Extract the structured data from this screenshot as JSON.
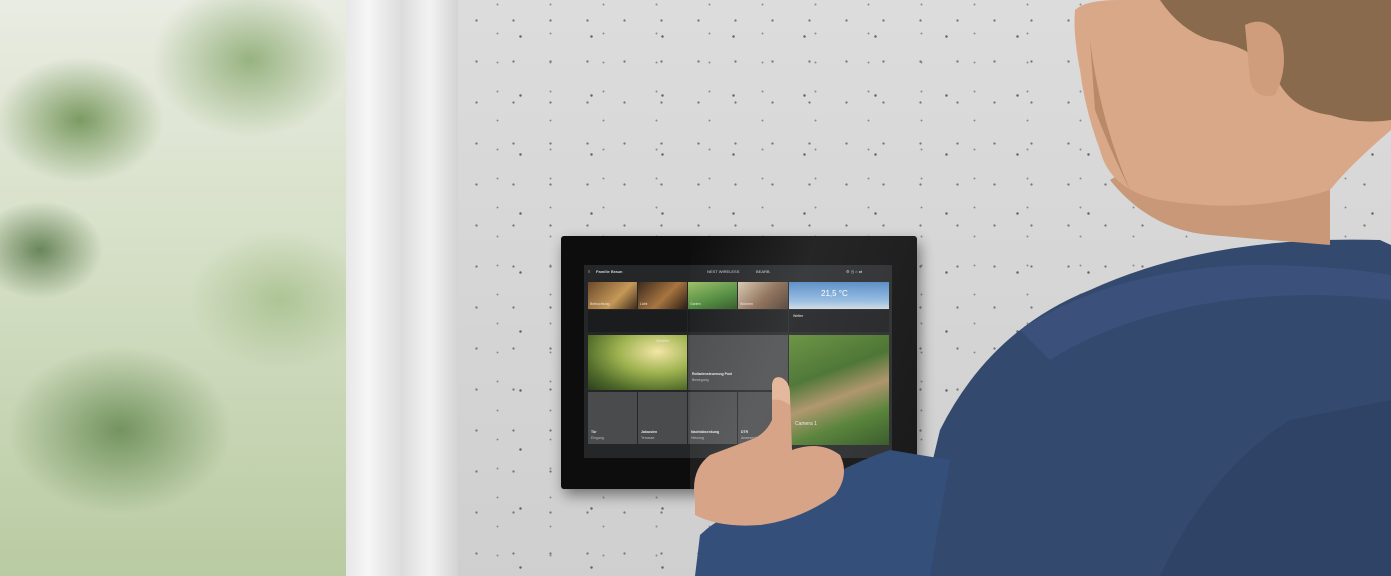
{
  "screen": {
    "header_title": "Familie Braun",
    "header_status": "NEST WIRELESS",
    "header_action": "BEARB.",
    "weather_temp": "21,5 °C",
    "tiles": {
      "scene1": "Beleuchtung",
      "scene2": "Licht",
      "scene3": "Garten",
      "scene4": "Wohnen",
      "weather": "Wetter",
      "garden_photo": "Weather",
      "blinds_title": "Rolladensteuerung Pool",
      "blinds_sub": "Bewegung",
      "camera": "Camera 1",
      "bottom1_title": "Tür",
      "bottom1_sub": "Eingang",
      "bottom2_title": "Jalousien",
      "bottom2_sub": "Terrasse",
      "bottom3_title": "Nachtabsenkung",
      "bottom3_sub": "Heizung",
      "bottom4_title": "DTR",
      "bottom4_sub": "Anwesenheit"
    }
  }
}
